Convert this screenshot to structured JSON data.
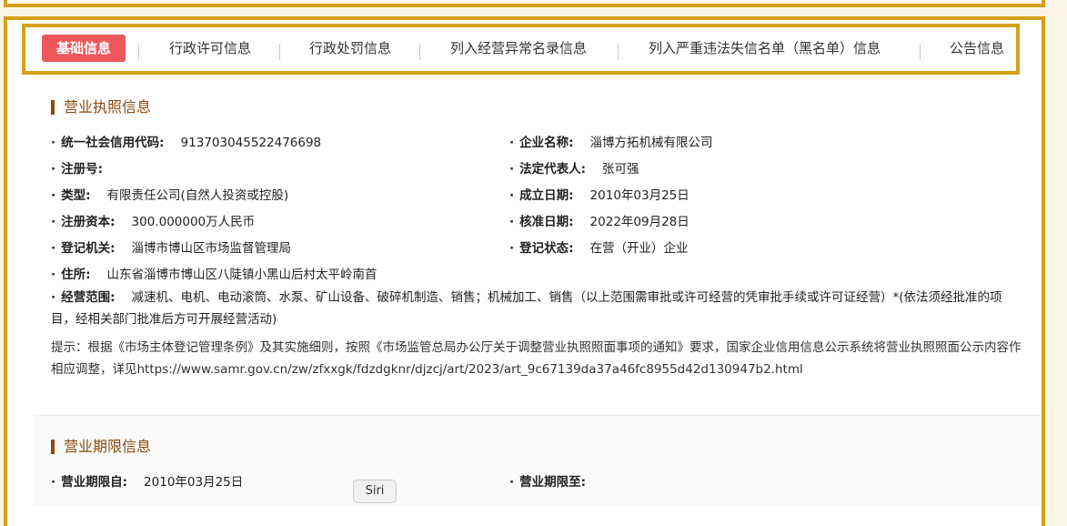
{
  "tabs": [
    {
      "label": "基础信息",
      "active": true
    },
    {
      "label": "行政许可信息"
    },
    {
      "label": "行政处罚信息"
    },
    {
      "label": "列入经营异常名录信息"
    },
    {
      "label": "列入严重违法失信名单（黑名单）信息"
    },
    {
      "label": "公告信息"
    }
  ],
  "license": {
    "section_title": "营业执照信息",
    "fields": {
      "credit_code": {
        "label": "统一社会信用代码:",
        "value": "913703045522476698"
      },
      "company_name": {
        "label": "企业名称:",
        "value": "淄博方拓机械有限公司"
      },
      "reg_no": {
        "label": "注册号:",
        "value": ""
      },
      "legal_rep": {
        "label": "法定代表人:",
        "value": "张可强"
      },
      "type": {
        "label": "类型:",
        "value": "有限责任公司(自然人投资或控股)"
      },
      "established": {
        "label": "成立日期:",
        "value": "2010年03月25日"
      },
      "capital": {
        "label": "注册资本:",
        "value": "300.000000万人民币"
      },
      "approved": {
        "label": "核准日期:",
        "value": "2022年09月28日"
      },
      "authority": {
        "label": "登记机关:",
        "value": "淄博市博山区市场监督管理局"
      },
      "status": {
        "label": "登记状态:",
        "value": "在营（开业）企业"
      },
      "address": {
        "label": "住所:",
        "value": "山东省淄博市博山区八陡镇小黑山后村太平岭南首"
      },
      "scope": {
        "label": "经营范围:",
        "value": "减速机、电机、电动滚筒、水泵、矿山设备、破碎机制造、销售；机械加工、销售（以上范围需审批或许可经营的凭审批手续或许可证经营）*(依法须经批准的项目，经相关部门批准后方可开展经营活动)"
      }
    },
    "hint": "提示：根据《市场主体登记管理条例》及其实施细则，按照《市场监管总局办公厅关于调整营业执照照面事项的通知》要求，国家企业信用信息公示系统将营业执照照面公示内容作相应调整，详见https://www.samr.gov.cn/zw/zfxxgk/fdzdgknr/djzcj/art/2023/art_9c67139da37a46fc8955d42d130947b2.html"
  },
  "period": {
    "section_title": "营业期限信息",
    "from": {
      "label": "营业期限自:",
      "value": "2010年03月25日"
    },
    "to": {
      "label": "营业期限至:",
      "value": ""
    }
  },
  "siri": "Siri",
  "colors": {
    "accent": "#d4a017",
    "active_tab": "#f0575a",
    "title": "#8a4a10"
  }
}
